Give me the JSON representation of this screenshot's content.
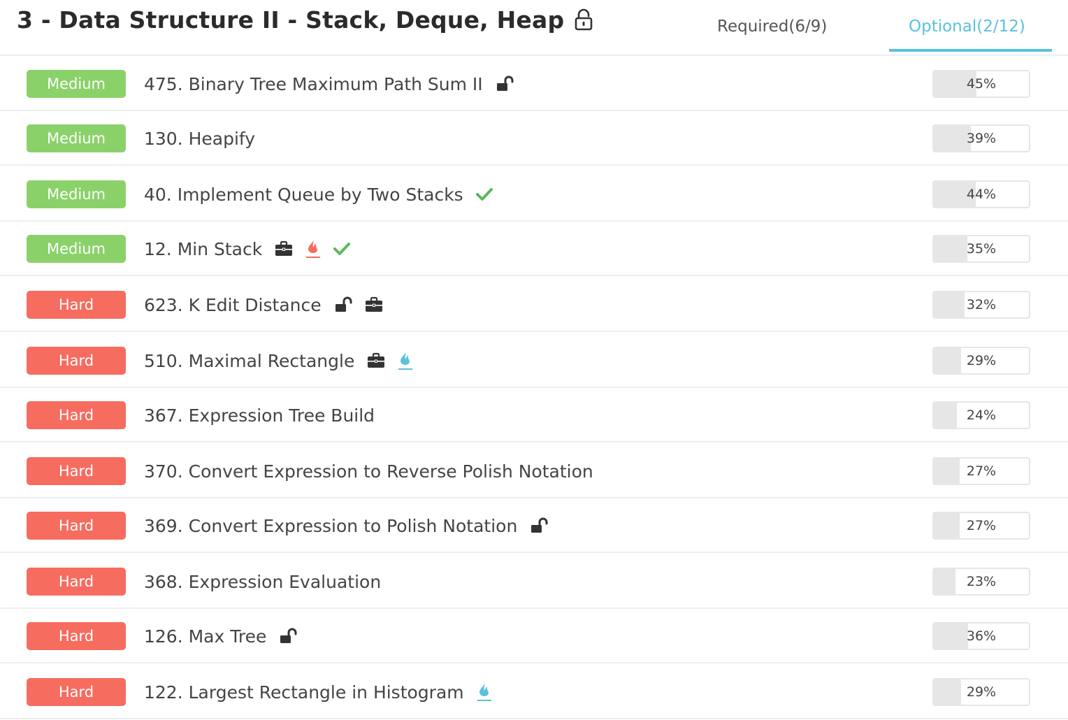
{
  "header": {
    "title": "3 - Data Structure II - Stack, Deque, Heap",
    "tabs": [
      {
        "label": "Required(6/9)",
        "active": false
      },
      {
        "label": "Optional(2/12)",
        "active": true
      }
    ]
  },
  "colors": {
    "medium": "#8bd16a",
    "hard": "#f66c5f",
    "accent": "#5bc0de",
    "check": "#5cb85c",
    "hot_red": "#f66c5f",
    "hot_blue": "#5bc0de"
  },
  "problems": [
    {
      "difficulty": "Medium",
      "title": "475. Binary Tree Maximum Path Sum II",
      "icons": [
        "unlock-icon"
      ],
      "rate": "45%",
      "rate_value": 45
    },
    {
      "difficulty": "Medium",
      "title": "130. Heapify",
      "icons": [],
      "rate": "39%",
      "rate_value": 39
    },
    {
      "difficulty": "Medium",
      "title": "40. Implement Queue by Two Stacks",
      "icons": [
        "check-icon"
      ],
      "rate": "44%",
      "rate_value": 44
    },
    {
      "difficulty": "Medium",
      "title": "12. Min Stack",
      "icons": [
        "briefcase-icon",
        "flame-red-icon",
        "check-icon"
      ],
      "rate": "35%",
      "rate_value": 35
    },
    {
      "difficulty": "Hard",
      "title": "623. K Edit Distance",
      "icons": [
        "unlock-icon",
        "briefcase-icon"
      ],
      "rate": "32%",
      "rate_value": 32
    },
    {
      "difficulty": "Hard",
      "title": "510. Maximal Rectangle",
      "icons": [
        "briefcase-icon",
        "flame-blue-icon"
      ],
      "rate": "29%",
      "rate_value": 29
    },
    {
      "difficulty": "Hard",
      "title": "367. Expression Tree Build",
      "icons": [],
      "rate": "24%",
      "rate_value": 24
    },
    {
      "difficulty": "Hard",
      "title": "370. Convert Expression to Reverse Polish Notation",
      "icons": [],
      "rate": "27%",
      "rate_value": 27
    },
    {
      "difficulty": "Hard",
      "title": "369. Convert Expression to Polish Notation",
      "icons": [
        "unlock-icon"
      ],
      "rate": "27%",
      "rate_value": 27
    },
    {
      "difficulty": "Hard",
      "title": "368. Expression Evaluation",
      "icons": [],
      "rate": "23%",
      "rate_value": 23
    },
    {
      "difficulty": "Hard",
      "title": "126. Max Tree",
      "icons": [
        "unlock-icon"
      ],
      "rate": "36%",
      "rate_value": 36
    },
    {
      "difficulty": "Hard",
      "title": "122. Largest Rectangle in Histogram",
      "icons": [
        "flame-blue-icon"
      ],
      "rate": "29%",
      "rate_value": 29
    }
  ]
}
